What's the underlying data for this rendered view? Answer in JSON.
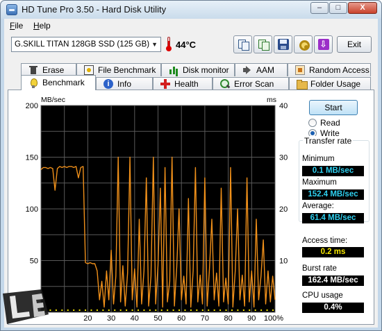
{
  "window": {
    "title": "HD Tune Pro 3.50 - Hard Disk Utility",
    "buttons": {
      "minimize": "–",
      "maximize": "□",
      "close": "X"
    }
  },
  "menu": {
    "file": "File",
    "file_accel": "F",
    "file_rest": "ile",
    "help": "Help",
    "help_accel": "H",
    "help_rest": "elp"
  },
  "toolbar": {
    "drive": "G.SKILL TITAN 128GB SSD (125 GB)",
    "temperature": "44°C",
    "exit_label": "Exit",
    "icons": [
      "copy-text-icon",
      "copy-all-icon",
      "save-icon",
      "options-icon",
      "exit-arrow-icon"
    ]
  },
  "tabs": {
    "row1": [
      "Erase",
      "File Benchmark",
      "Disk monitor",
      "AAM",
      "Random Access"
    ],
    "row2": [
      "Benchmark",
      "Info",
      "Health",
      "Error Scan",
      "Folder Usage"
    ],
    "active": "Benchmark"
  },
  "controls": {
    "start_label": "Start",
    "read_label": "Read",
    "write_label": "Write",
    "selected": "Write"
  },
  "transfer_rate": {
    "title": "Transfer rate",
    "minimum_label": "Minimum",
    "minimum_value": "0.1 MB/sec",
    "maximum_label": "Maximum",
    "maximum_value": "152.4 MB/sec",
    "average_label": "Average:",
    "average_value": "61.4 MB/sec"
  },
  "stats": {
    "access_label": "Access time:",
    "access_value": "0.2 ms",
    "burst_label": "Burst rate",
    "burst_value": "162.4 MB/sec",
    "cpu_label": "CPU usage",
    "cpu_value": "0.4%"
  },
  "chart_data": {
    "type": "line",
    "ylabel": "MB/sec",
    "y2label": "ms",
    "ylim": [
      0,
      200
    ],
    "y2lim": [
      0,
      40
    ],
    "y_ticks": [
      "200",
      "150",
      "100",
      "50"
    ],
    "y2_ticks": [
      "40",
      "30",
      "20",
      "10"
    ],
    "x_ticks": [
      "20",
      "30",
      "40",
      "50",
      "60",
      "70",
      "80",
      "90",
      "100%"
    ],
    "xlim": [
      0,
      100
    ],
    "grid": true,
    "background": "#000000",
    "series_color": "#f0901a",
    "series": [
      {
        "values_x": [
          0,
          1,
          2,
          3,
          4,
          5,
          6,
          7,
          8,
          9,
          10,
          11,
          12,
          13,
          14,
          15,
          16,
          17,
          18,
          19,
          20,
          21,
          22,
          23,
          24,
          25,
          26,
          27,
          28,
          29,
          30,
          31,
          32,
          33,
          34,
          35,
          36,
          37,
          38,
          39,
          40,
          41,
          42,
          43,
          44,
          45,
          46,
          47,
          48,
          49,
          50,
          51,
          52,
          53,
          54,
          55,
          56,
          57,
          58,
          59,
          60,
          61,
          62,
          63,
          64,
          65,
          66,
          67,
          68,
          69,
          70,
          71,
          72,
          73,
          74,
          75,
          76,
          77,
          78,
          79,
          80,
          81,
          82,
          83,
          84,
          85,
          86,
          87,
          88,
          89,
          90,
          91,
          92,
          93,
          94,
          95,
          96,
          97,
          98,
          99,
          100
        ],
        "values_y": [
          138,
          140,
          140,
          139,
          140,
          139,
          118,
          139,
          141,
          140,
          141,
          140,
          141,
          141,
          140,
          141,
          130,
          140,
          141,
          48,
          47,
          48,
          47,
          47,
          40,
          12,
          30,
          5,
          40,
          12,
          60,
          8,
          35,
          150,
          10,
          45,
          6,
          38,
          150,
          12,
          42,
          5,
          90,
          8,
          40,
          130,
          6,
          35,
          150,
          8,
          45,
          120,
          5,
          140,
          10,
          30,
          150,
          6,
          44,
          100,
          12,
          35,
          8,
          110,
          5,
          40,
          140,
          10,
          36,
          8,
          130,
          6,
          42,
          90,
          12,
          38,
          6,
          120,
          10,
          33,
          8,
          140,
          5,
          40,
          100,
          12,
          36,
          6,
          130,
          10,
          40,
          5,
          90,
          12,
          35,
          70,
          8,
          40,
          10,
          35,
          12
        ]
      }
    ]
  },
  "colors": {
    "accent": "#f0901a",
    "value_text": "#2fd0f0",
    "cpu_text": "#f7e800",
    "start_button": "#bfe1f6"
  }
}
